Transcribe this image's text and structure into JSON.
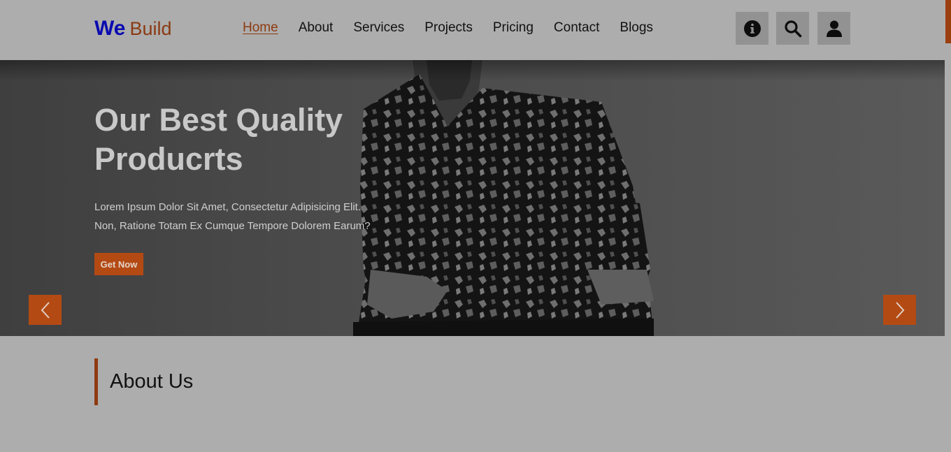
{
  "brand": {
    "part1": "We",
    "part2": "Build",
    "color1": "#0a0ab0",
    "color2": "#8a3a12"
  },
  "nav": {
    "items": [
      {
        "label": "Home",
        "active": true
      },
      {
        "label": "About",
        "active": false
      },
      {
        "label": "Services",
        "active": false
      },
      {
        "label": "Projects",
        "active": false
      },
      {
        "label": "Pricing",
        "active": false
      },
      {
        "label": "Contact",
        "active": false
      },
      {
        "label": "Blogs",
        "active": false
      }
    ]
  },
  "header_actions": {
    "icons": [
      "info-icon",
      "search-icon",
      "user-icon"
    ]
  },
  "hero": {
    "title_line1": "Our Best Quality",
    "title_line2": "Producrts",
    "text_line1": "Lorem Ipsum Dolor Sit Amet, Consectetur Adipisicing Elit.",
    "text_line2": "Non, Ratione Totam Ex Cumque Tempore Dolorem Earum?",
    "cta_label": "Get Now",
    "prev_icon": "chevron-left-icon",
    "next_icon": "chevron-right-icon"
  },
  "about": {
    "heading": "About Us"
  },
  "colors": {
    "accent": "#b44a13",
    "accent_dark": "#8e3a10",
    "overlay_bg": "#adadad"
  }
}
